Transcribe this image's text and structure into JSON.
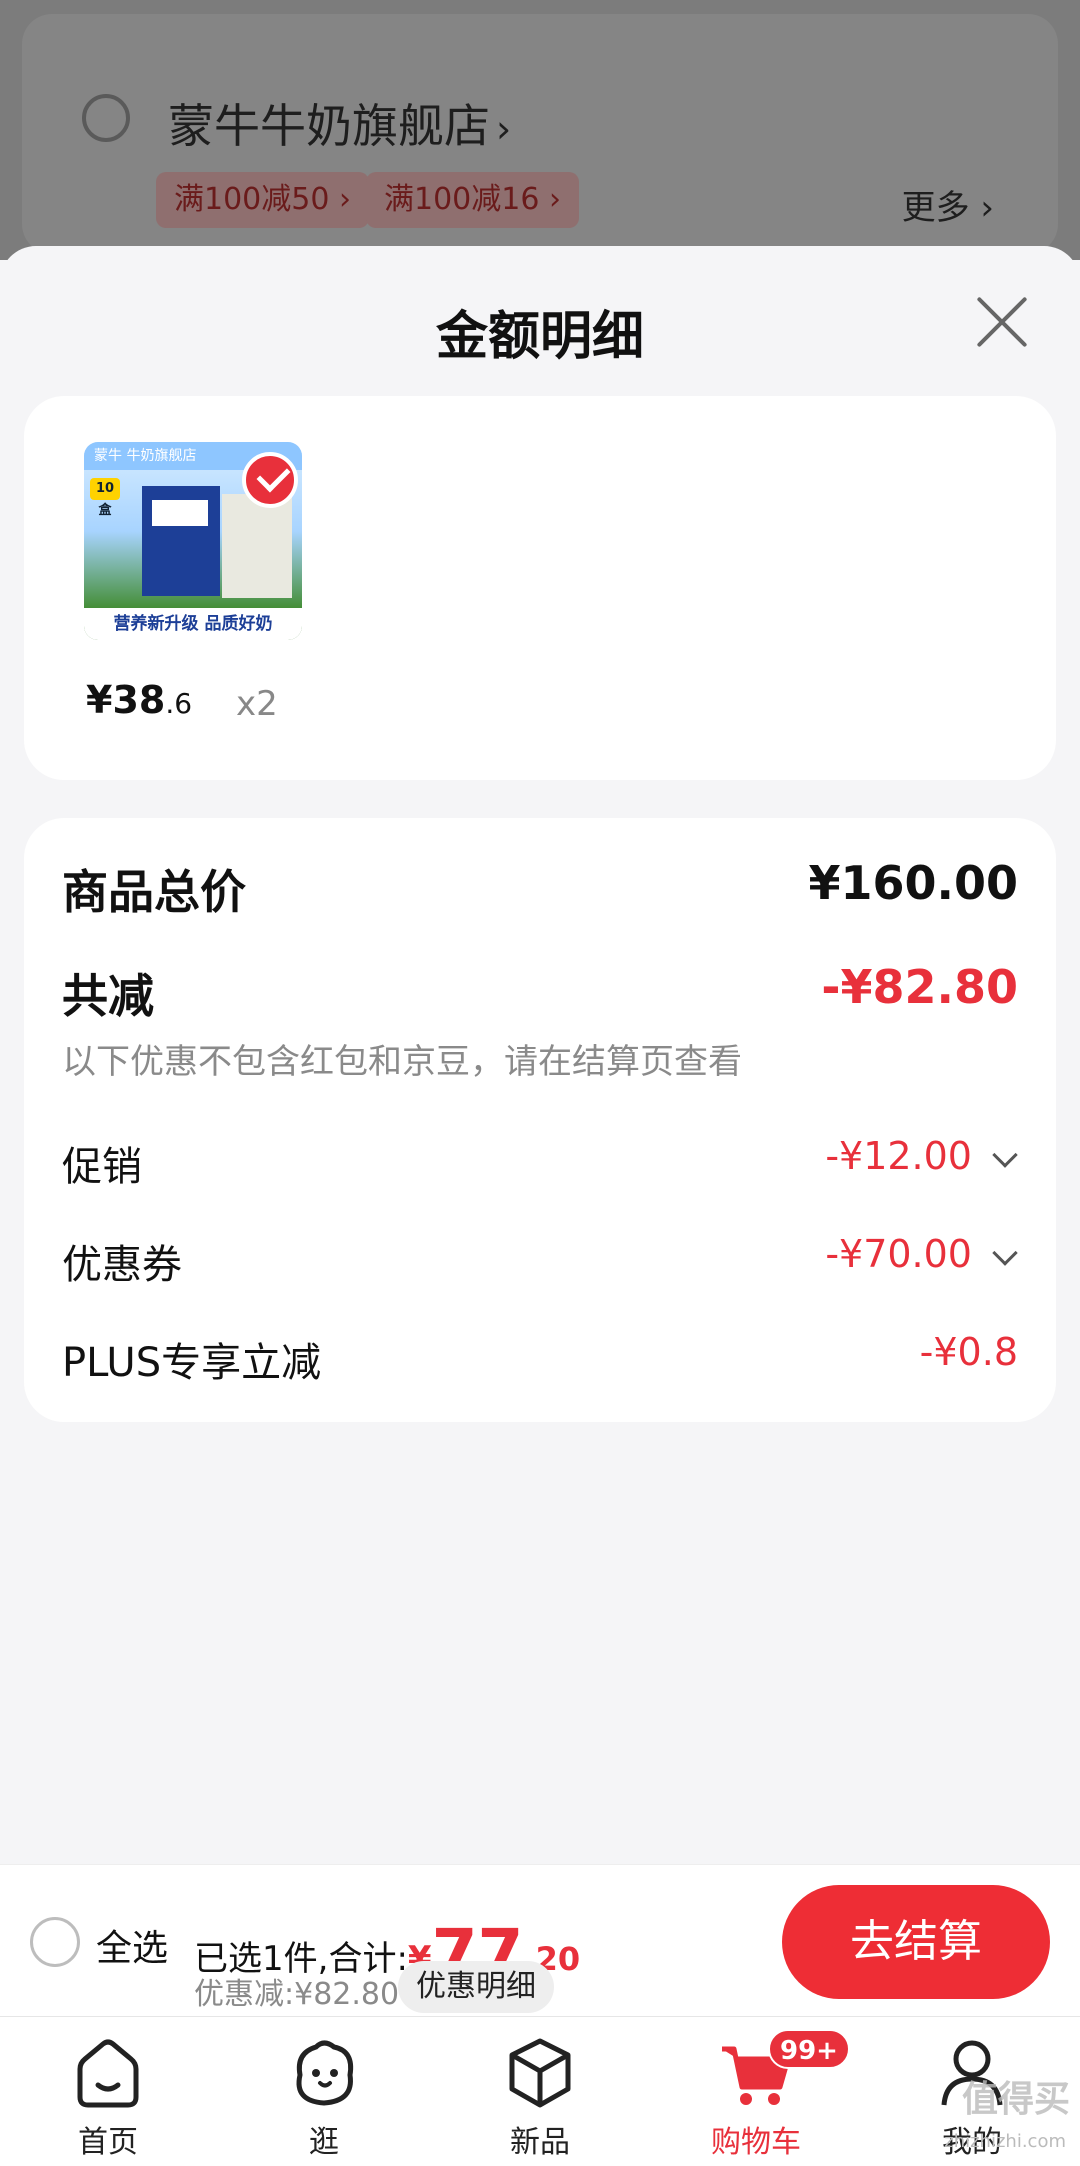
{
  "background": {
    "shop_name": "蒙牛牛奶旗舰店",
    "tags": [
      "满100减50 ›",
      "满100减16 ›"
    ],
    "more": "更多 ›"
  },
  "sheet": {
    "title": "金额明细",
    "product": {
      "image_top_text": "蒙牛 牛奶旗舰店",
      "image_badge": "10盒",
      "image_caption": "营养新升级 品质好奶",
      "price_symbol": "¥",
      "price_int": "38",
      "price_dec": ".6",
      "quantity": "x2"
    },
    "summary": {
      "total_label": "商品总价",
      "total_value": "¥160.00",
      "reduce_label": "共减",
      "reduce_value": "-¥82.80",
      "note": "以下优惠不包含红包和京豆，请在结算页查看",
      "promo_label": "促销",
      "promo_value": "-¥12.00",
      "coupon_label": "优惠券",
      "coupon_value": "-¥70.00",
      "plus_label": "PLUS专享立减",
      "plus_value": "-¥0.8"
    }
  },
  "checkout": {
    "select_all": "全选",
    "selected_info": "已选1件,合计:",
    "total_symbol": "¥",
    "total_int": "77",
    "total_dec": ".20",
    "discount_line": "优惠减:¥82.80",
    "detail_button": "优惠明细",
    "checkout_button": "去结算"
  },
  "tabbar": {
    "home": "首页",
    "stroll": "逛",
    "new": "新品",
    "cart": "购物车",
    "cart_badge": "99+",
    "mine": "我的"
  },
  "watermark": {
    "main": "值得买",
    "sub": "zhizhizhi.com"
  },
  "colors": {
    "accent": "#e8303b",
    "checkout_button": "#ee2d35"
  }
}
